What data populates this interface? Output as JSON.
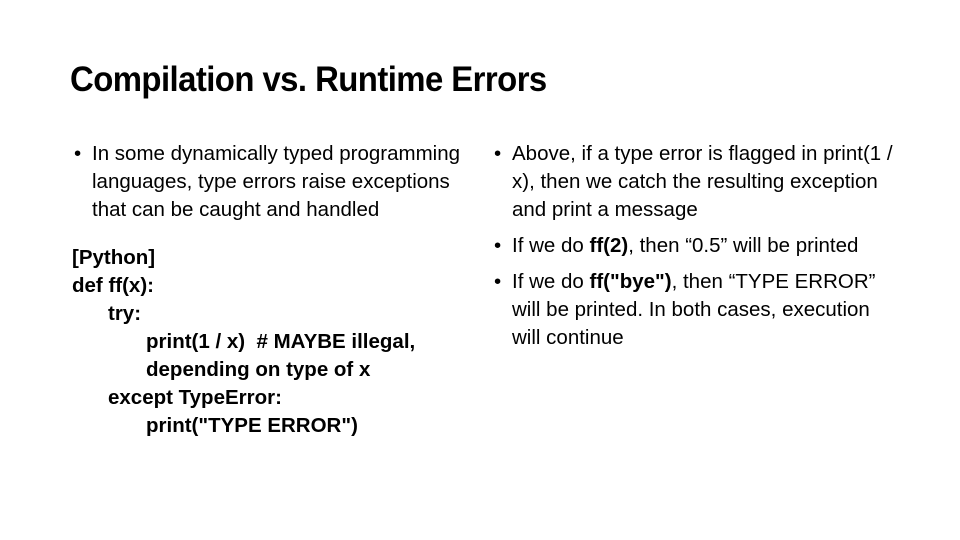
{
  "slide": {
    "title": "Compilation vs. Runtime Errors",
    "background_color": "#ffffff",
    "text_color": "#000000",
    "bullet_glyph": "•"
  },
  "left_column": {
    "bullets": [
      {
        "text": "In some dynamically typed programming languages, type errors raise exceptions that can be caught and handled"
      }
    ],
    "code_block": {
      "lines": [
        {
          "indent": 0,
          "text": "[Python]"
        },
        {
          "indent": 0,
          "text": "def ff(x):"
        },
        {
          "indent": 1,
          "text": "try:"
        },
        {
          "indent": 2,
          "text": "print(1 / x)  # MAYBE illegal,"
        },
        {
          "indent": 2,
          "text": "depending on type of x"
        },
        {
          "indent": 1,
          "text": "except TypeError:"
        },
        {
          "indent": 2,
          "text": "print(\"TYPE ERROR\")"
        }
      ]
    }
  },
  "right_column": {
    "bullets": [
      {
        "parts": [
          {
            "text": "Above, if a type error is flagged in print(1 / x), then we catch the resulting exception and print a message",
            "bold": false
          }
        ]
      },
      {
        "parts": [
          {
            "text": "If we do ",
            "bold": false
          },
          {
            "text": "ff(2)",
            "bold": true
          },
          {
            "text": ", then “0.5” will be printed",
            "bold": false
          }
        ]
      },
      {
        "parts": [
          {
            "text": "If we do ",
            "bold": false
          },
          {
            "text": "ff(\"bye\")",
            "bold": true
          },
          {
            "text": ", then “TYPE ERROR” will be printed. In both cases, execution will continue",
            "bold": false
          }
        ]
      }
    ]
  }
}
